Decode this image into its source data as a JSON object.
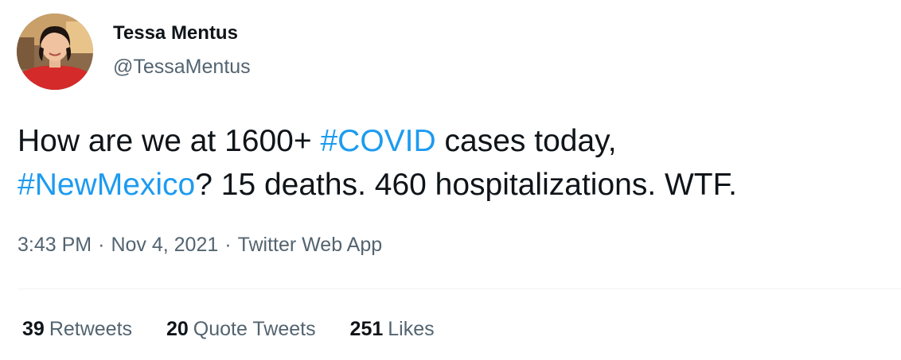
{
  "author": {
    "name": "Tessa Mentus",
    "handle": "@TessaMentus",
    "avatar_icon": "profile-photo-avatar"
  },
  "tweet": {
    "line1_before": "How are we at 1600+ ",
    "line1_hashtag": "#COVID",
    "line1_after": " cases today,",
    "line2_hashtag": "#NewMexico",
    "line2_after": "? 15 deaths. 460 hospitalizations.  WTF."
  },
  "meta": {
    "time": "3:43 PM",
    "separator": "·",
    "date": "Nov 4, 2021",
    "source": "Twitter Web App"
  },
  "stats": {
    "retweets_count": "39",
    "retweets_label": "Retweets",
    "quotes_count": "20",
    "quotes_label": "Quote Tweets",
    "likes_count": "251",
    "likes_label": "Likes"
  },
  "colors": {
    "link": "#1d9bf0",
    "text": "#0f1419",
    "secondary": "#536471",
    "divider": "#eff3f4"
  }
}
